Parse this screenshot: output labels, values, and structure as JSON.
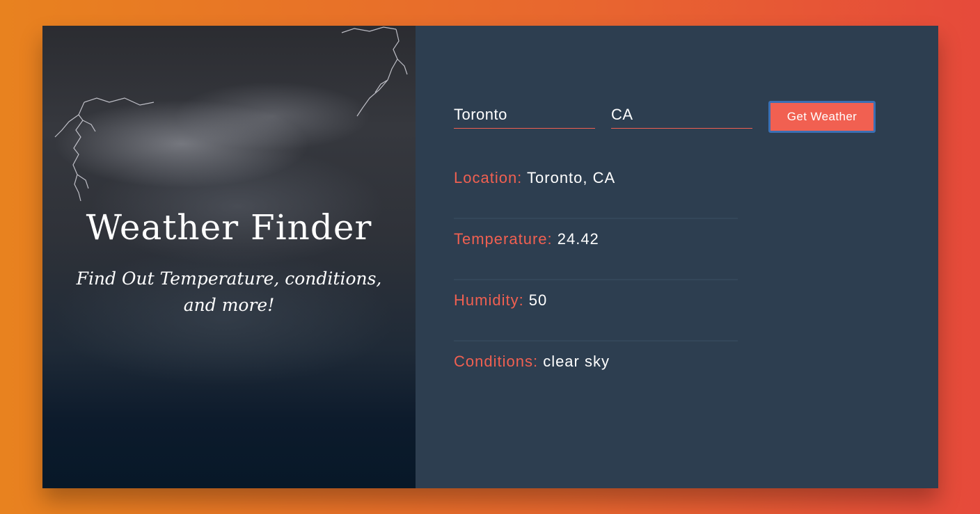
{
  "hero": {
    "title": "Weather Finder",
    "subtitle": "Find Out Temperature, conditions, and more!"
  },
  "form": {
    "city_value": "Toronto",
    "country_value": "CA",
    "button_label": "Get Weather"
  },
  "results": {
    "location_label": "Location:",
    "location_value": "Toronto, CA",
    "temperature_label": "Temperature:",
    "temperature_value": "24.42",
    "humidity_label": "Humidity:",
    "humidity_value": "50",
    "conditions_label": "Conditions:",
    "conditions_value": "clear sky"
  },
  "colors": {
    "accent": "#f16051",
    "panel_bg": "#2d3e50",
    "button_border": "#3b6fb3"
  }
}
